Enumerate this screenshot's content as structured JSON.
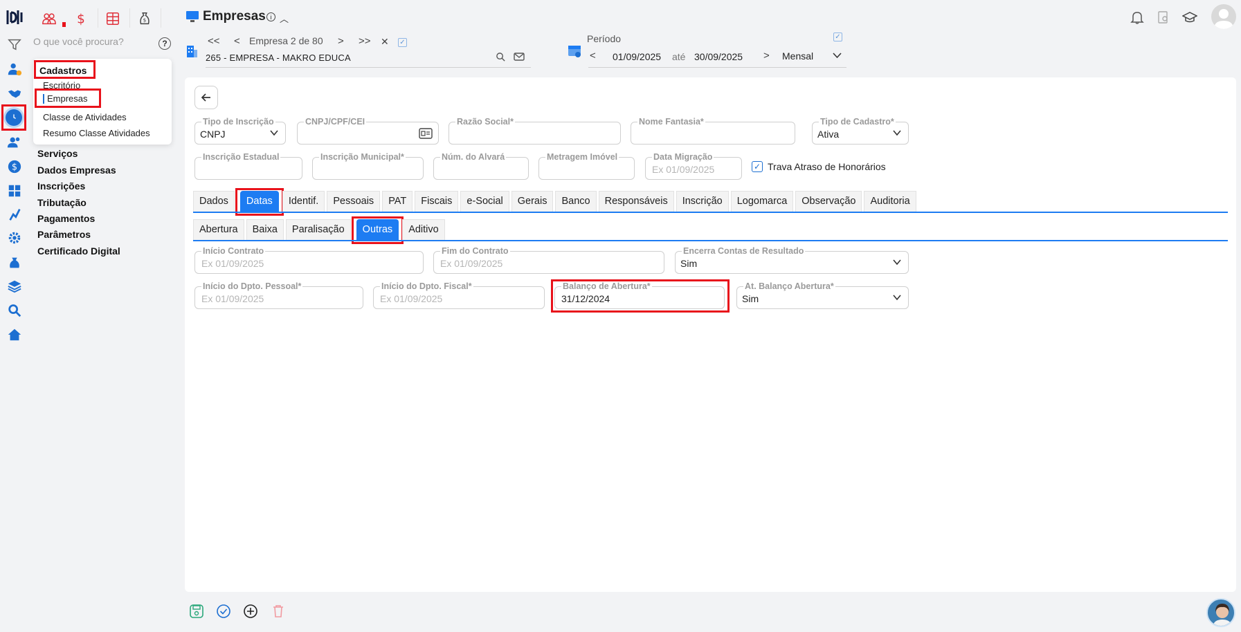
{
  "header": {
    "title": "Empresas",
    "company_nav": {
      "first": "<<",
      "prev": "<",
      "label": "Empresa 2 de 80",
      "next": ">",
      "last": ">>",
      "close": "✕"
    },
    "company_name": "265 - EMPRESA - MAKRO EDUCA",
    "periodo": {
      "label": "Período",
      "from": "01/09/2025",
      "sep": "até",
      "to": "30/09/2025",
      "freq": "Mensal"
    }
  },
  "nav": {
    "search_placeholder": "O que você procura?",
    "help": "?",
    "submenu": {
      "title": "Cadastros",
      "items": [
        "Escritório",
        "Empresas",
        "Classe de Atividades",
        "Resumo Classe Atividades"
      ]
    },
    "items": [
      "Serviços",
      "Dados Empresas",
      "Inscrições",
      "Tributação",
      "Pagamentos",
      "Parâmetros",
      "Certificado Digital"
    ]
  },
  "form": {
    "tipo_inscricao": {
      "label": "Tipo de Inscrição",
      "value": "CNPJ"
    },
    "cnpj": {
      "label": "CNPJ/CPF/CEI"
    },
    "razao_social": {
      "label": "Razão Social*"
    },
    "nome_fantasia": {
      "label": "Nome Fantasia*"
    },
    "tipo_cadastro": {
      "label": "Tipo de Cadastro*",
      "value": "Ativa"
    },
    "inscricao_estadual": {
      "label": "Inscrição Estadual"
    },
    "inscricao_municipal": {
      "label": "Inscrição Municipal*"
    },
    "num_alvara": {
      "label": "Núm. do Alvará"
    },
    "metragem": {
      "label": "Metragem Imóvel"
    },
    "data_migracao": {
      "label": "Data Migração",
      "placeholder": "Ex 01/09/2025"
    },
    "trava": {
      "label": "Trava Atraso de Honorários",
      "checked": true
    }
  },
  "tabs": [
    "Dados",
    "Datas",
    "Identif.",
    "Pessoais",
    "PAT",
    "Fiscais",
    "e-Social",
    "Gerais",
    "Banco",
    "Responsáveis",
    "Inscrição",
    "Logomarca",
    "Observação",
    "Auditoria"
  ],
  "subtabs": [
    "Abertura",
    "Baixa",
    "Paralisação",
    "Outras",
    "Aditivo"
  ],
  "datas": {
    "inicio_contrato": {
      "label": "Início Contrato",
      "placeholder": "Ex 01/09/2025"
    },
    "fim_contrato": {
      "label": "Fim do Contrato",
      "placeholder": "Ex 01/09/2025"
    },
    "encerra": {
      "label": "Encerra Contas de Resultado",
      "value": "Sim"
    },
    "inicio_pessoal": {
      "label": "Início do Dpto. Pessoal*",
      "placeholder": "Ex 01/09/2025"
    },
    "inicio_fiscal": {
      "label": "Início do Dpto. Fiscal*",
      "placeholder": "Ex 01/09/2025"
    },
    "balanco": {
      "label": "Balanço de Abertura*",
      "value": "31/12/2024"
    },
    "at_balanco": {
      "label": "At. Balanço Abertura*",
      "value": "Sim"
    }
  },
  "colors": {
    "accent": "#1d7cf2",
    "highlight": "#e8121b",
    "module": "#e0303a"
  }
}
